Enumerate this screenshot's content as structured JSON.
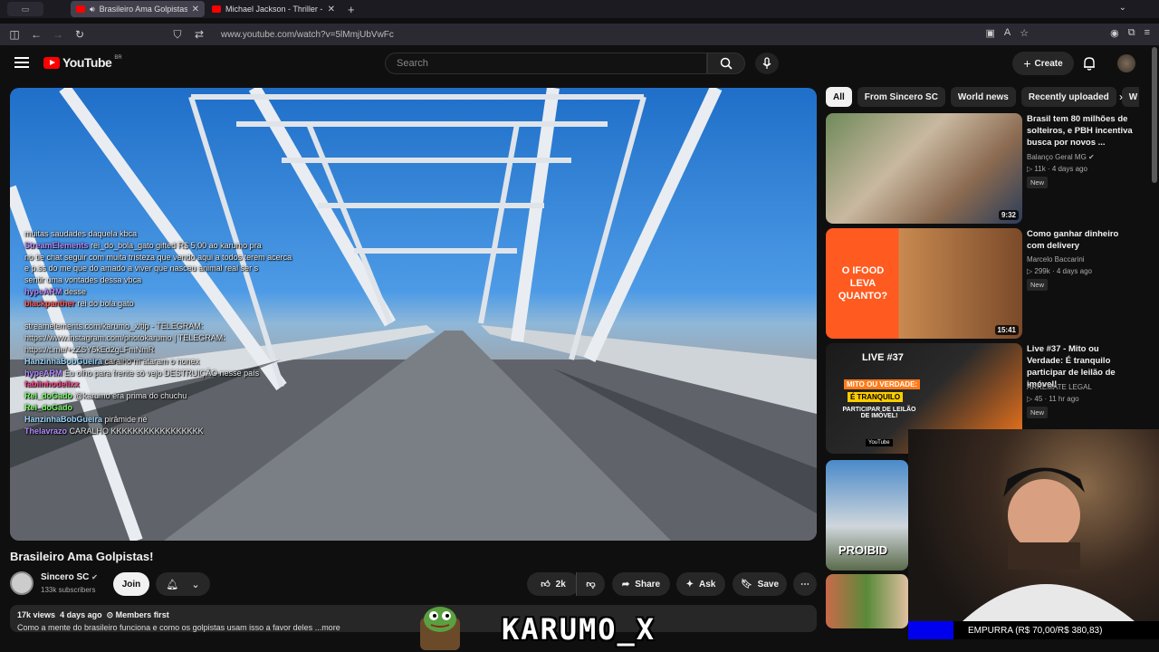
{
  "browser": {
    "tabs": [
      {
        "title": "Brasileiro Ama Golpistas! - ",
        "active": true
      },
      {
        "title": "Michael Jackson - Thriller - Thr",
        "active": false
      }
    ],
    "url": "www.youtube.com/watch?v=5lMmjUbVwFc"
  },
  "youtube": {
    "logo_text": "YouTube",
    "country": "BR",
    "search_placeholder": "Search",
    "create_label": "Create"
  },
  "video": {
    "title": "Brasileiro Ama Golpistas!",
    "channel": "Sincero SC",
    "subscribers": "133k subscribers",
    "join_label": "Join",
    "likes": "2k",
    "share_label": "Share",
    "ask_label": "Ask",
    "save_label": "Save",
    "views": "17k views",
    "age": "4 days ago",
    "members": "Members first",
    "description": "Como a mente do brasileiro funciona e como os golpistas usam isso a favor deles",
    "more": "...more"
  },
  "chat": [
    {
      "user": "",
      "text": "muitas saudades daquela kbca"
    },
    {
      "user": "StreamElements",
      "text": "rei_do_bola_gato gifted R$ 5,00 ao karumo pra"
    },
    {
      "user": "",
      "text": "no tie chat seguir com muita tristeza que vendo aqui a todos terem acerca"
    },
    {
      "user": "",
      "text": "e p.ss do me que do amado a viver que nasceu animal real ser s"
    },
    {
      "user": "",
      "text": "sentir uma vontades dessa vbca"
    },
    {
      "user": "hypeARM",
      "text": "desse"
    },
    {
      "user": "blackpanther",
      "text": "rei do bola gato"
    },
    {
      "user": "",
      "text": ""
    },
    {
      "user": "",
      "text": "streamelements.com/karumo_x/tip - TELEGRAM:"
    },
    {
      "user": "",
      "text": "https://www.instagram.com/photokarumo | TELEGRAM:"
    },
    {
      "user": "",
      "text": "https://t.me/+zZSY5kEd2gLFmNmR"
    },
    {
      "user": "HanzinhaBobGueira",
      "text": "caralho m ataram o nonex"
    },
    {
      "user": "hypeARM",
      "text": "Eu olho para frente só vejo DESTRUIÇÃO nesse país"
    },
    {
      "user": "fabiinhodelixx",
      "text": ""
    },
    {
      "user": "Rei_doGado",
      "text": "@karumo era prima do chuchu"
    },
    {
      "user": "Rei_doGado",
      "text": ""
    },
    {
      "user": "HanzinhaBobGueira",
      "text": "pirâmide né"
    },
    {
      "user": "Thelavrazo",
      "text": "CARALHO KKKKKKKKKKKKKKKKK"
    }
  ],
  "chips": [
    "All",
    "From Sincero SC",
    "World news",
    "Recently uploaded",
    "W"
  ],
  "recommendations": [
    {
      "title": "Brasil tem 80 milhões de solteiros, e PBH incentiva busca por novos ...",
      "channel": "Balanço Geral MG",
      "views": "11k",
      "age": "4 days ago",
      "badge": "New",
      "duration": "9:32",
      "verified": true
    },
    {
      "title": "Como ganhar dinheiro com delivery",
      "channel": "Marcelo Baccarini",
      "views": "299k",
      "age": "4 days ago",
      "badge": "New",
      "duration": "15:41",
      "verified": false,
      "thumb_text": "O IFOOD LEVA QUANTO?"
    },
    {
      "title": "Live #37 - Mito ou Verdade: É tranquilo participar de leilão de imóvel!",
      "channel": "ARREMATE LEGAL",
      "views": "45",
      "age": "11 hr ago",
      "badge": "New",
      "duration": "",
      "verified": false,
      "thumb_text": "LIVE #37",
      "thumb_sub": "MITO OU VERDADE:",
      "thumb_sub2": "É TRANQUILO",
      "thumb_sub3": "PARTICIPAR DE LEILÃO DE IMÓVEL!",
      "thumb_logo": "YouTube"
    },
    {
      "title": "",
      "thumb_text": "PROIBID"
    }
  ],
  "stream_overlay": {
    "goal_text": "EMPURRA (R$ 70,00/R$ 380,83)",
    "streamer_name": "KARUMO_X"
  },
  "colors": {
    "youtube_red": "#ff0000",
    "bg": "#0f0f0f"
  }
}
